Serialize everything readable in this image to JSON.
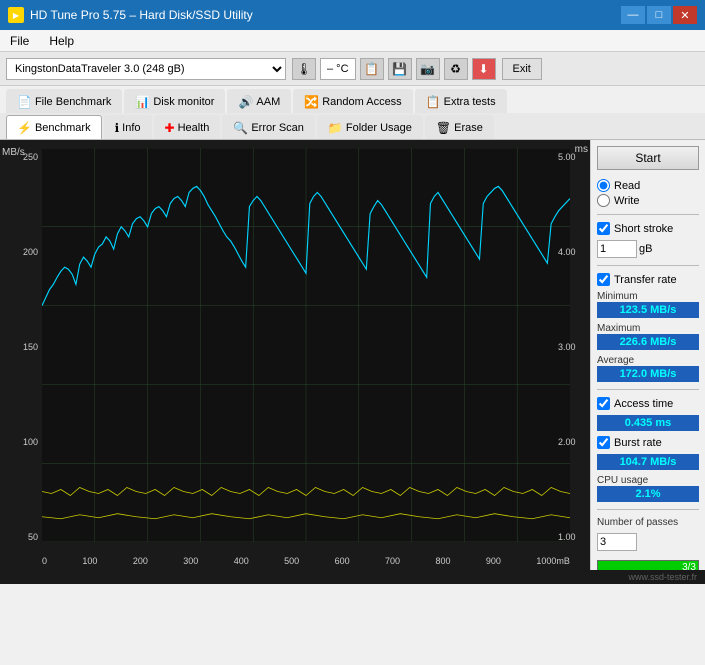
{
  "titleBar": {
    "title": "HD Tune Pro 5.75 – Hard Disk/SSD Utility",
    "minBtn": "—",
    "maxBtn": "□",
    "closeBtn": "✕"
  },
  "menuBar": {
    "items": [
      "File",
      "Help"
    ]
  },
  "toolbar": {
    "deviceName": "KingstonDataTraveler 3.0 (248 gB)",
    "temperature": "– °C",
    "exitLabel": "Exit"
  },
  "tabs": {
    "row1": [
      {
        "label": "File Benchmark",
        "icon": "📄"
      },
      {
        "label": "Disk monitor",
        "icon": "📊"
      },
      {
        "label": "AAM",
        "icon": "🔊"
      },
      {
        "label": "Random Access",
        "icon": "🔀"
      },
      {
        "label": "Extra tests",
        "icon": "📋"
      }
    ],
    "row2": [
      {
        "label": "Benchmark",
        "icon": "⚡",
        "active": true
      },
      {
        "label": "Info",
        "icon": "ℹ"
      },
      {
        "label": "Health",
        "icon": "➕"
      },
      {
        "label": "Error Scan",
        "icon": "🔍"
      },
      {
        "label": "Folder Usage",
        "icon": "📁"
      },
      {
        "label": "Erase",
        "icon": "🗑"
      }
    ]
  },
  "chart": {
    "yAxisLeft": "MB/s",
    "yAxisRight": "ms",
    "yLeftMax": "250",
    "yLeftMid": "200",
    "yLeftLow": "150",
    "yLeftLow2": "100",
    "yLeftLow3": "50",
    "yRightMax": "5.00",
    "yRightMid": "4.00",
    "yRightMid2": "3.00",
    "yRightLow": "2.00",
    "yRightLow2": "1.00",
    "xLabels": [
      "0",
      "100",
      "200",
      "300",
      "400",
      "500",
      "600",
      "700",
      "800",
      "900",
      "1000mB"
    ]
  },
  "controls": {
    "startLabel": "Start",
    "readLabel": "Read",
    "writeLabel": "Write",
    "shortStrokeLabel": "Short stroke",
    "shortStrokeValue": "1",
    "shortStrokeUnit": "gB",
    "transferRateLabel": "Transfer rate",
    "minimum": {
      "label": "Minimum",
      "value": "123.5 MB/s"
    },
    "maximum": {
      "label": "Maximum",
      "value": "226.6 MB/s"
    },
    "average": {
      "label": "Average",
      "value": "172.0 MB/s"
    },
    "accessTime": {
      "label": "Access time",
      "value": "0.435 ms"
    },
    "burstRate": {
      "label": "Burst rate",
      "value": "104.7 MB/s"
    },
    "cpuUsage": {
      "label": "CPU usage",
      "value": "2.1%"
    },
    "numberOfPasses": {
      "label": "Number of passes",
      "value": "3"
    },
    "progressText": "3/3",
    "progressPercent": 100
  },
  "watermark": "www.ssd-tester.fr"
}
